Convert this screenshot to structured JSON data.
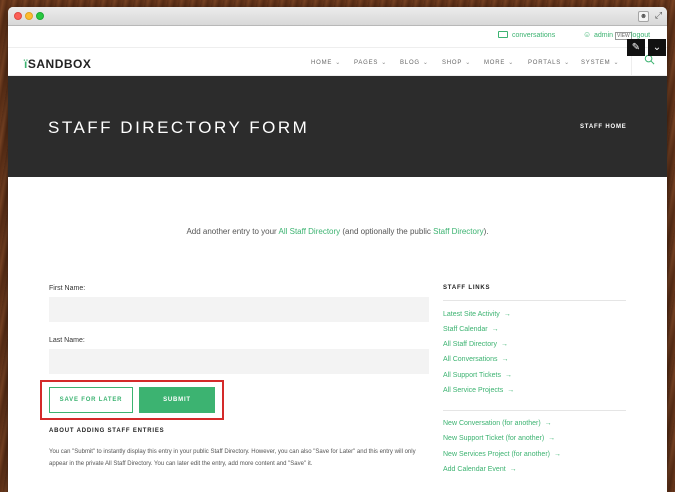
{
  "topbar": {
    "conversations": "conversations",
    "user": "admin",
    "user_badge": "VIEW",
    "logout": "logout"
  },
  "logo": {
    "text": "SANDBOX"
  },
  "nav": {
    "items": [
      {
        "label": "HOME"
      },
      {
        "label": "PAGES"
      },
      {
        "label": "BLOG"
      },
      {
        "label": "SHOP"
      },
      {
        "label": "MORE"
      },
      {
        "label": "PORTALS"
      },
      {
        "label": "SYSTEM"
      }
    ]
  },
  "hero": {
    "title": "STAFF DIRECTORY FORM",
    "breadcrumb": "STAFF HOME"
  },
  "intro": {
    "prefix": "Add another entry to your ",
    "link1": "All Staff Directory",
    "middle": " (and optionally the public ",
    "link2": "Staff Directory",
    "suffix": ")."
  },
  "form": {
    "first_name_label": "First Name:",
    "first_name_value": "",
    "last_name_label": "Last Name:",
    "last_name_value": "",
    "save_later_label": "SAVE FOR LATER",
    "submit_label": "SUBMIT"
  },
  "about": {
    "title": "ABOUT ADDING STAFF ENTRIES",
    "text": "You can \"Submit\" to instantly display this entry in your public Staff Directory. However, you can also \"Save for Later\" and this entry will only appear in the private All Staff Directory. You can later edit the entry, add more content and \"Save\" it."
  },
  "sidebar": {
    "title": "STAFF LINKS",
    "links": [
      {
        "label": "Latest Site Activity"
      },
      {
        "label": "Staff Calendar"
      },
      {
        "label": "All Staff Directory"
      },
      {
        "label": "All Conversations"
      },
      {
        "label": "All Support Tickets"
      },
      {
        "label": "All Service Projects"
      }
    ],
    "links2": [
      {
        "label": "New Conversation (for another)"
      },
      {
        "label": "New Support Ticket (for another)"
      },
      {
        "label": "New Services Project (for another)"
      },
      {
        "label": "Add Calendar Event"
      }
    ]
  },
  "colors": {
    "accent": "#3cb371",
    "hero_bg": "#2c2c2c",
    "highlight_box": "#d42a2a"
  }
}
